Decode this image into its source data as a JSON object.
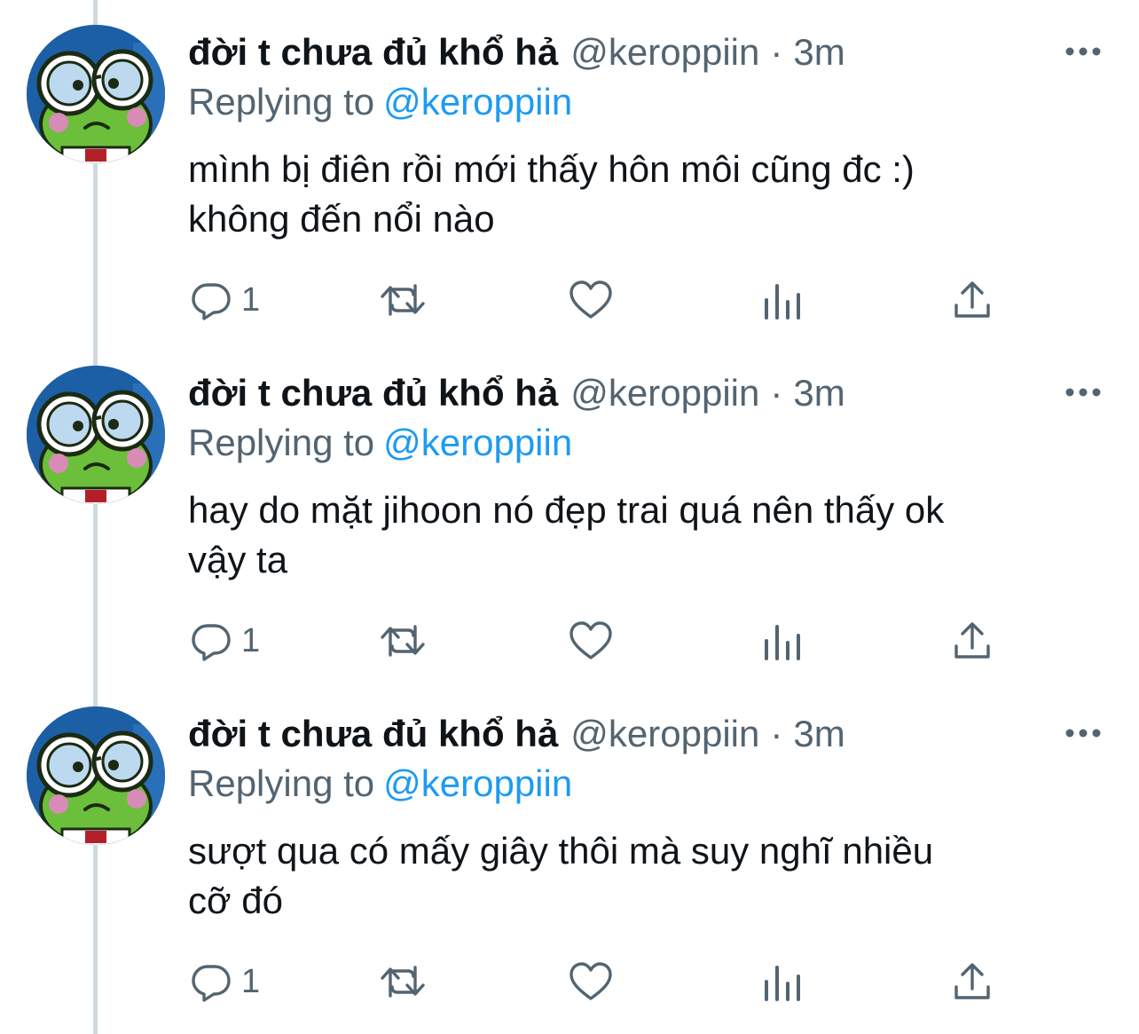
{
  "tweets": [
    {
      "display_name": "đời t chưa đủ khổ hả",
      "handle": "@keroppiin",
      "separator": "·",
      "time": "3m",
      "replying_label": "Replying to",
      "replying_to": "@keroppiin",
      "text_lines": [
        "mình bị điên rồi mới thấy hôn môi cũng đc :)",
        "không đến nổi nào"
      ],
      "reply_count": "1"
    },
    {
      "display_name": "đời t chưa đủ khổ hả",
      "handle": "@keroppiin",
      "separator": "·",
      "time": "3m",
      "replying_label": "Replying to",
      "replying_to": "@keroppiin",
      "text_lines": [
        "hay do mặt jihoon nó đẹp trai quá nên thấy ok",
        "vậy ta"
      ],
      "reply_count": "1"
    },
    {
      "display_name": "đời t chưa đủ khổ hả",
      "handle": "@keroppiin",
      "separator": "·",
      "time": "3m",
      "replying_label": "Replying to",
      "replying_to": "@keroppiin",
      "text_lines": [
        "sượt qua có mấy giây thôi mà suy nghĩ nhiều",
        "cỡ đó"
      ],
      "reply_count": "1"
    }
  ],
  "icons": {
    "avatar": "keroppi-frog-avatar",
    "more": "more-horizontal-icon",
    "reply": "reply-bubble-icon",
    "retweet": "retweet-icon",
    "like": "heart-icon",
    "views": "views-bar-chart-icon",
    "share": "share-upload-icon"
  },
  "colors": {
    "text_primary": "#0f1419",
    "text_secondary": "#536471",
    "mention": "#1d9bf0",
    "thread_line": "#cfd9de"
  }
}
